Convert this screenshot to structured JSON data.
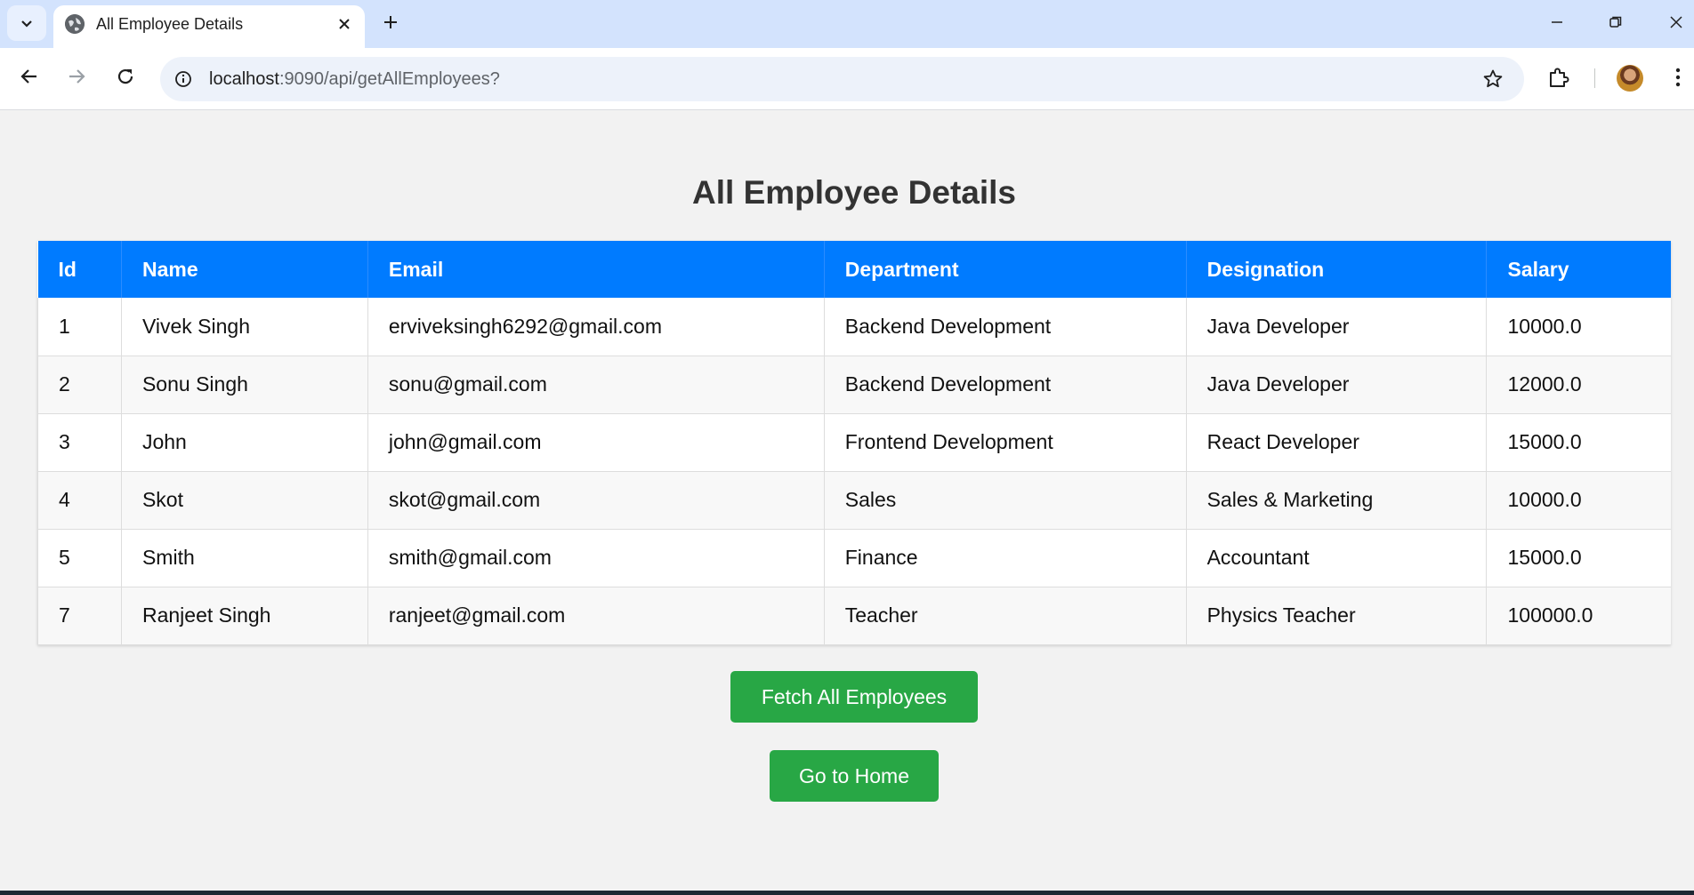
{
  "browser": {
    "tab_title": "All Employee Details",
    "url_host": "localhost",
    "url_rest": ":9090/api/getAllEmployees?",
    "icons": {
      "tab_search": "chevron-down-icon",
      "favicon": "globe-icon",
      "tab_close": "close-icon",
      "new_tab": "plus-icon",
      "back": "arrow-left-icon",
      "forward": "arrow-right-icon",
      "reload": "reload-icon",
      "site_info": "info-icon",
      "bookmark": "star-icon",
      "extensions": "puzzle-icon",
      "menu": "kebab-menu-icon"
    }
  },
  "page": {
    "title": "All Employee Details",
    "columns": [
      "Id",
      "Name",
      "Email",
      "Department",
      "Designation",
      "Salary"
    ],
    "rows": [
      [
        "1",
        "Vivek Singh",
        "erviveksingh6292@gmail.com",
        "Backend Development",
        "Java Developer",
        "10000.0"
      ],
      [
        "2",
        "Sonu Singh",
        "sonu@gmail.com",
        "Backend Development",
        "Java Developer",
        "12000.0"
      ],
      [
        "3",
        "John",
        "john@gmail.com",
        "Frontend Development",
        "React Developer",
        "15000.0"
      ],
      [
        "4",
        "Skot",
        "skot@gmail.com",
        "Sales",
        "Sales & Marketing",
        "10000.0"
      ],
      [
        "5",
        "Smith",
        "smith@gmail.com",
        "Finance",
        "Accountant",
        "15000.0"
      ],
      [
        "7",
        "Ranjeet Singh",
        "ranjeet@gmail.com",
        "Teacher",
        "Physics Teacher",
        "100000.0"
      ]
    ],
    "fetch_button": "Fetch All Employees",
    "home_button": "Go to Home"
  },
  "colors": {
    "header_blue": "#007bff",
    "button_green": "#28a745",
    "page_bg": "#f2f2f2"
  }
}
